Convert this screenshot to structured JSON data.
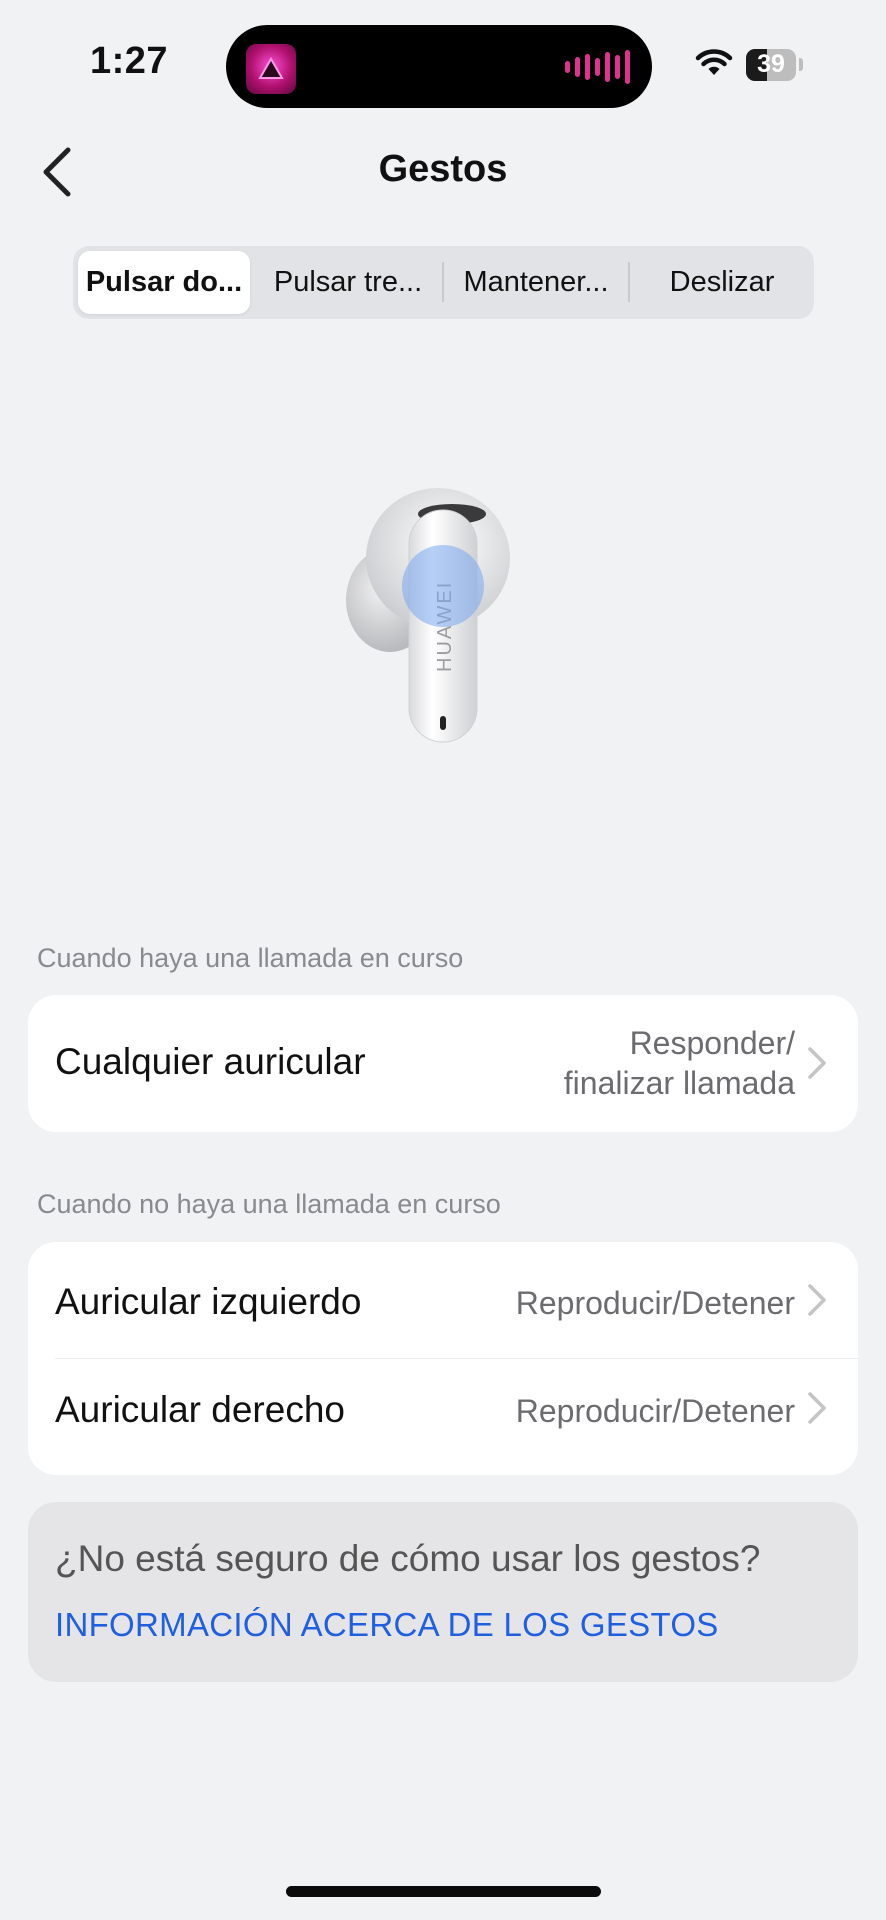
{
  "status_bar": {
    "time": "1:27",
    "battery": "39",
    "audio_bar_color": "#e0338f"
  },
  "header": {
    "title": "Gestos",
    "back_icon": "chevron-left-icon"
  },
  "tabs": [
    {
      "label": "Pulsar do...",
      "active": true
    },
    {
      "label": "Pulsar tre...",
      "active": false
    },
    {
      "label": "Mantener...",
      "active": false
    },
    {
      "label": "Deslizar",
      "active": false
    }
  ],
  "illustration": {
    "brand_text": "HUAWEI"
  },
  "section_call": {
    "label": "Cuando haya una llamada en curso",
    "rows": [
      {
        "label": "Cualquier auricular",
        "value_line1": "Responder/",
        "value_line2": "finalizar llamada"
      }
    ]
  },
  "section_no_call": {
    "label": "Cuando no haya una llamada en curso",
    "rows": [
      {
        "label": "Auricular izquierdo",
        "value": "Reproducir/Detener"
      },
      {
        "label": "Auricular derecho",
        "value": "Reproducir/Detener"
      }
    ]
  },
  "info": {
    "question": "¿No está seguro de cómo usar los gestos?",
    "link": "INFORMACIÓN ACERCA DE LOS GESTOS",
    "link_color": "#1f5fe0"
  }
}
